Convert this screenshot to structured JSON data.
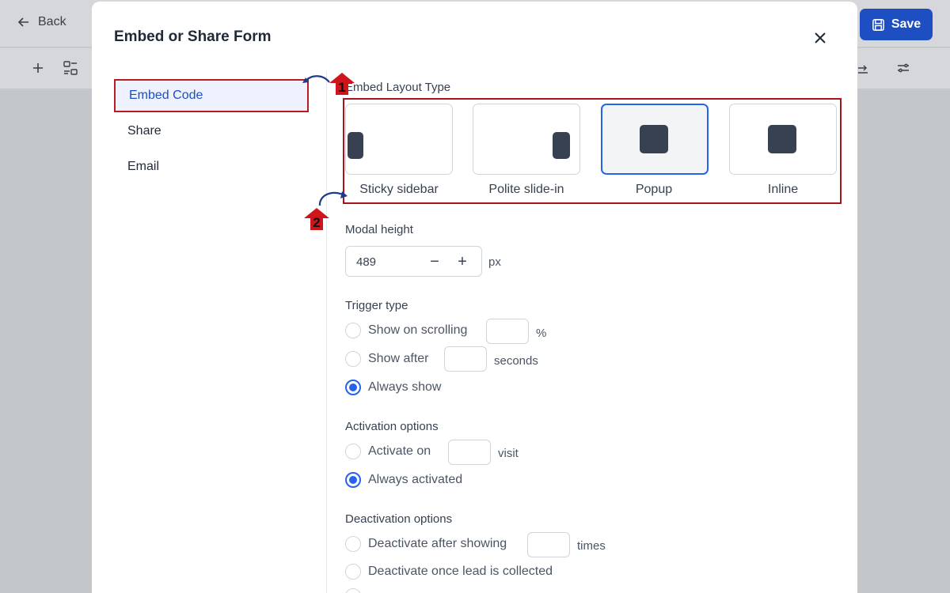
{
  "app": {
    "back_label": "Back",
    "save_label": "Save"
  },
  "modal": {
    "title": "Embed or Share Form",
    "sidebar": [
      {
        "label": "Embed Code",
        "active": true
      },
      {
        "label": "Share",
        "active": false
      },
      {
        "label": "Email",
        "active": false
      }
    ],
    "embed_layout": {
      "label": "Embed Layout Type",
      "options": [
        {
          "label": "Sticky sidebar",
          "selected": false
        },
        {
          "label": "Polite slide-in",
          "selected": false
        },
        {
          "label": "Popup",
          "selected": true
        },
        {
          "label": "Inline",
          "selected": false
        }
      ]
    },
    "modal_height": {
      "label": "Modal height",
      "value": "489",
      "minus": "−",
      "plus": "+",
      "unit": "px"
    },
    "trigger": {
      "label": "Trigger type",
      "options": [
        {
          "label": "Show on scrolling",
          "unit": "%",
          "checked": false
        },
        {
          "label": "Show after",
          "unit": "seconds",
          "checked": false
        },
        {
          "label": "Always show",
          "checked": true
        }
      ]
    },
    "activation": {
      "label": "Activation options",
      "options": [
        {
          "label": "Activate on",
          "unit": "visit",
          "checked": false
        },
        {
          "label": "Always activated",
          "checked": true
        }
      ]
    },
    "deactivation": {
      "label": "Deactivation options",
      "options": [
        {
          "label": "Deactivate after showing",
          "unit": "times",
          "checked": false
        },
        {
          "label": "Deactivate once lead is collected",
          "checked": false
        }
      ]
    }
  },
  "annotations": {
    "step1": "1",
    "step2": "2"
  },
  "colors": {
    "primary": "#1d4ec2",
    "annotation_red": "#a4161a"
  }
}
